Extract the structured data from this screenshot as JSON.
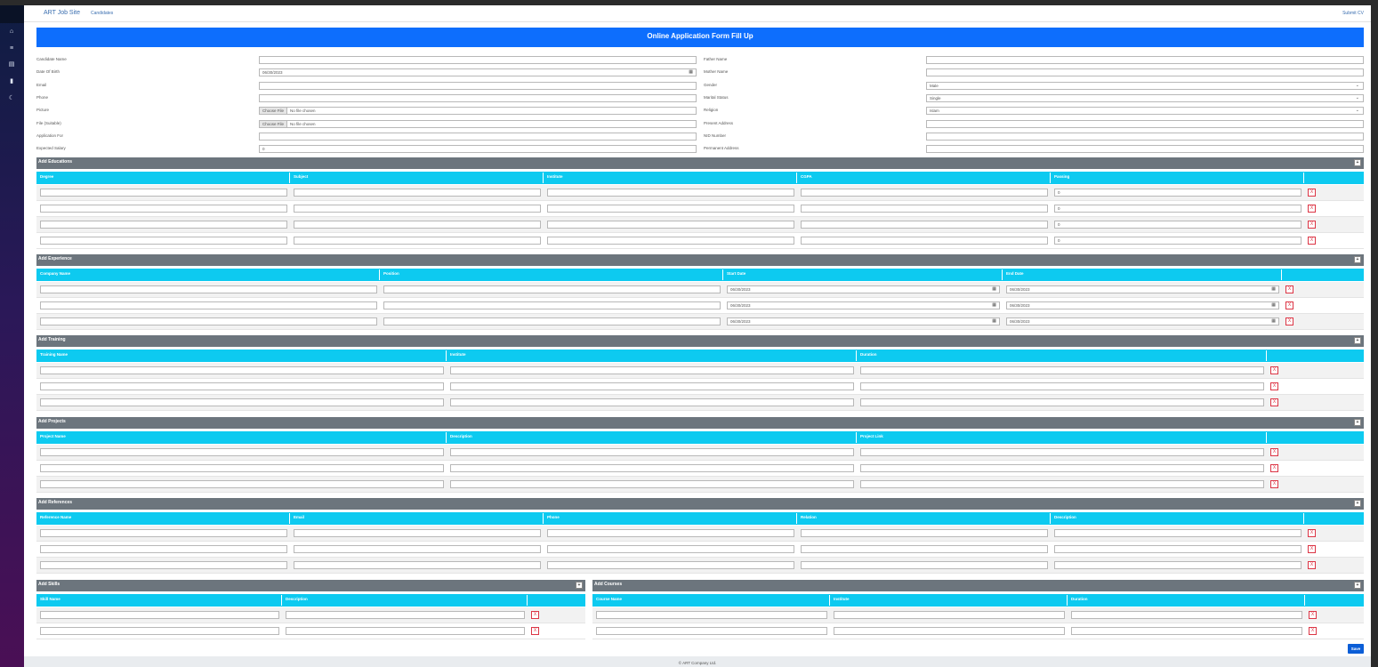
{
  "navbar": {
    "brand": "ART Job Site",
    "link": "Candidates",
    "submit": "Submit CV"
  },
  "form_title": "Online Application Form Fill Up",
  "fields_left": [
    {
      "label": "Candidate Name",
      "value": "",
      "type": "text"
    },
    {
      "label": "Date Of Birth",
      "value": "06/30/2023",
      "type": "date"
    },
    {
      "label": "Email",
      "value": "",
      "type": "text"
    },
    {
      "label": "Phone",
      "value": "",
      "type": "text"
    },
    {
      "label": "Picture",
      "value": "No file chosen",
      "type": "file",
      "button": "Choose File"
    },
    {
      "label": "File (Suitable)",
      "value": "No file chosen",
      "type": "file",
      "button": "Choose File"
    },
    {
      "label": "Application For",
      "value": "",
      "type": "text"
    },
    {
      "label": "Expected Salary",
      "value": "0",
      "type": "text"
    }
  ],
  "fields_right": [
    {
      "label": "Father Name",
      "value": "",
      "type": "text"
    },
    {
      "label": "Mother Name",
      "value": "",
      "type": "text"
    },
    {
      "label": "Gender",
      "value": "Male",
      "type": "select"
    },
    {
      "label": "Marital Status",
      "value": "Single",
      "type": "select"
    },
    {
      "label": "Religion",
      "value": "Islam",
      "type": "select"
    },
    {
      "label": "Present Address",
      "value": "",
      "type": "text"
    },
    {
      "label": "NID Number",
      "value": "",
      "type": "text"
    },
    {
      "label": "Permanent Address",
      "value": "",
      "type": "text"
    }
  ],
  "sections": {
    "educations": {
      "title": "Add Educations",
      "toggle": "+",
      "columns": [
        "Degree",
        "Subject",
        "Institute",
        "CGPA",
        "Passing"
      ],
      "rows": [
        [
          "",
          "",
          "",
          "",
          "0"
        ],
        [
          "",
          "",
          "",
          "",
          "0"
        ],
        [
          "",
          "",
          "",
          "",
          "0"
        ],
        [
          "",
          "",
          "",
          "",
          "0"
        ]
      ]
    },
    "experience": {
      "title": "Add Experience",
      "toggle": "+",
      "columns": [
        "Company Name",
        "Position",
        "Start Date",
        "End Date"
      ],
      "rows": [
        [
          "",
          "",
          "06/30/2023",
          "06/30/2023"
        ],
        [
          "",
          "",
          "06/30/2023",
          "06/30/2023"
        ],
        [
          "",
          "",
          "06/30/2023",
          "06/30/2023"
        ]
      ]
    },
    "training": {
      "title": "Add Training",
      "toggle": "+",
      "columns": [
        "Training Name",
        "Institute",
        "Duration"
      ],
      "rows": [
        [
          "",
          "",
          ""
        ],
        [
          "",
          "",
          ""
        ],
        [
          "",
          "",
          ""
        ]
      ]
    },
    "projects": {
      "title": "Add Projects",
      "toggle": "+",
      "columns": [
        "Project Name",
        "Description",
        "Project Link"
      ],
      "rows": [
        [
          "",
          "",
          ""
        ],
        [
          "",
          "",
          ""
        ],
        [
          "",
          "",
          ""
        ]
      ]
    },
    "references": {
      "title": "Add References",
      "toggle": "+",
      "columns": [
        "Reference Name",
        "Email",
        "Phone",
        "Relation",
        "Description"
      ],
      "rows": [
        [
          "",
          "",
          "",
          "",
          ""
        ],
        [
          "",
          "",
          "",
          "",
          ""
        ],
        [
          "",
          "",
          "",
          "",
          ""
        ]
      ]
    },
    "skills": {
      "title": "Add Skills",
      "toggle": "+",
      "columns": [
        "Skill Name",
        "Description"
      ],
      "rows": [
        [
          "",
          ""
        ],
        [
          "",
          ""
        ]
      ]
    },
    "courses": {
      "title": "Add Courses",
      "toggle": "+",
      "columns": [
        "Course Name",
        "Institute",
        "Duration"
      ],
      "rows": [
        [
          "",
          "",
          ""
        ],
        [
          "",
          "",
          ""
        ]
      ]
    }
  },
  "remove_label": "X",
  "save_label": "Save",
  "footer": "© ART Company Ltd.",
  "sidebar_icons": [
    "home-icon",
    "list-icon",
    "document-icon",
    "bookmark-icon",
    "moon-icon"
  ],
  "colors": {
    "primary": "#0d6efd",
    "table_header": "#0dcaf0",
    "section_header": "#6c757d",
    "remove": "#dc3545"
  }
}
